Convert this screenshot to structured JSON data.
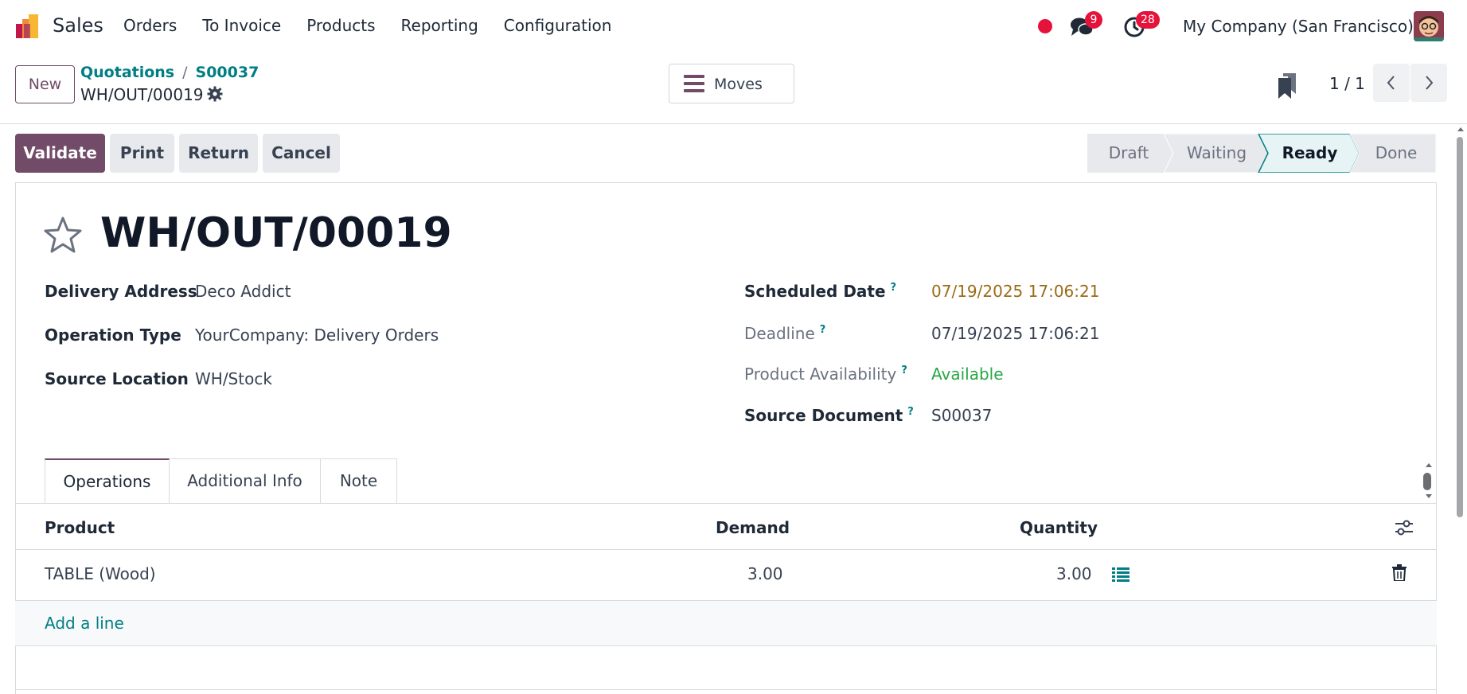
{
  "navbar": {
    "app_name": "Sales",
    "menu": [
      "Orders",
      "To Invoice",
      "Products",
      "Reporting",
      "Configuration"
    ],
    "chat_count": "9",
    "activity_count": "28",
    "company": "My Company (San Francisco)"
  },
  "control": {
    "new_label": "New",
    "breadcrumb": [
      "Quotations",
      "S00037"
    ],
    "breadcrumb_sep": "/",
    "record_name": "WH/OUT/00019",
    "moves_label": "Moves",
    "pager": "1 / 1"
  },
  "actions": {
    "validate": "Validate",
    "print": "Print",
    "return": "Return",
    "cancel": "Cancel"
  },
  "status": {
    "steps": [
      "Draft",
      "Waiting",
      "Ready",
      "Done"
    ],
    "current": "Ready"
  },
  "form": {
    "title": "WH/OUT/00019",
    "left_fields": [
      {
        "label": "Delivery Address",
        "value": "Deco Addict"
      },
      {
        "label": "Operation Type",
        "value": "YourCompany: Delivery Orders"
      },
      {
        "label": "Source Location",
        "value": "WH/Stock"
      }
    ],
    "right_fields": [
      {
        "label": "Scheduled Date",
        "value": "07/19/2025 17:06:21",
        "help": "?"
      },
      {
        "label": "Deadline",
        "value": "07/19/2025 17:06:21",
        "help": "?"
      },
      {
        "label": "Product Availability",
        "value": "Available",
        "help": "?"
      },
      {
        "label": "Source Document",
        "value": "S00037",
        "help": "?"
      }
    ]
  },
  "tabs": [
    "Operations",
    "Additional Info",
    "Note"
  ],
  "table": {
    "columns": [
      "Product",
      "Demand",
      "Quantity"
    ],
    "rows": [
      {
        "product": "TABLE (Wood)",
        "demand": "3.00",
        "quantity": "3.00"
      }
    ],
    "add_line": "Add a line"
  },
  "colors": {
    "brand": "#714b67",
    "link": "#017e84",
    "badge": "#e5123c",
    "warning_date": "#9b6b16",
    "available": "#28a745"
  },
  "icons": [
    "app-logo-icon",
    "chat-icon",
    "activity-clock-icon",
    "gear-icon",
    "list-menu-icon",
    "bookmark-icon",
    "chevron-left-icon",
    "chevron-right-icon",
    "star-icon",
    "column-settings-icon",
    "detail-list-icon",
    "trash-icon"
  ]
}
